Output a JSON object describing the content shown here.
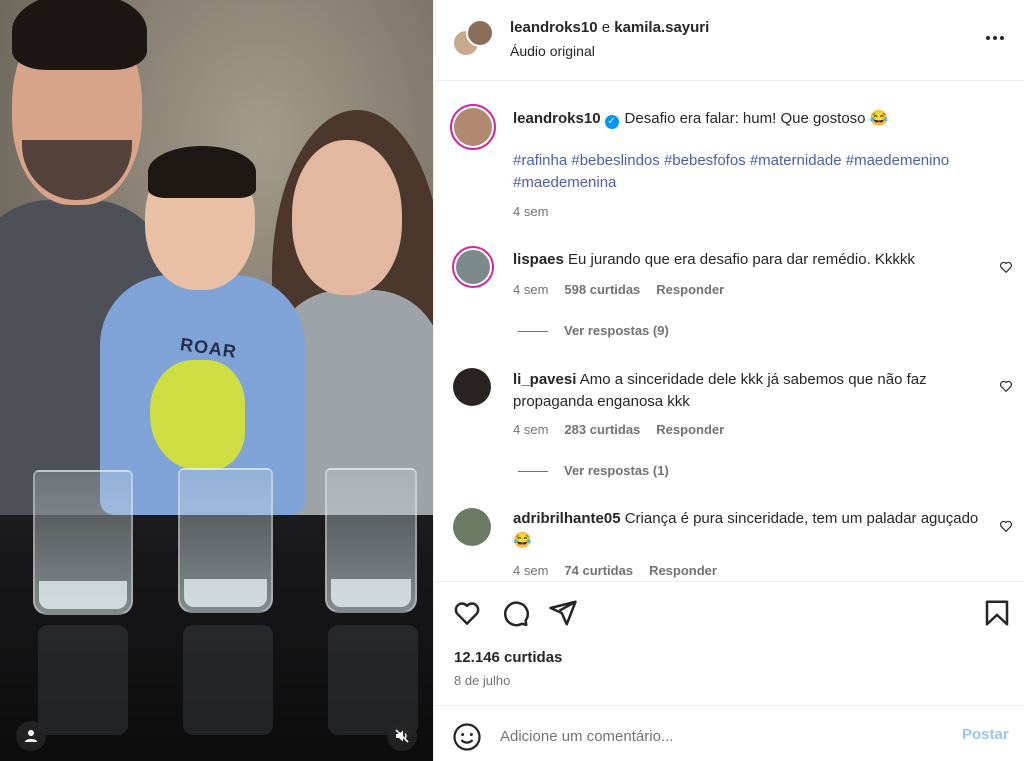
{
  "header": {
    "user1": "leandroks10",
    "connector": "e",
    "user2": "kamila.sayuri",
    "audio": "Áudio original"
  },
  "caption": {
    "username": "leandroks10",
    "text": "Desafio era falar: hum! Que gostoso 😂",
    "hashtags": "#rafinha #bebeslindos #bebesfofos #maternidade #maedemenino #maedemenina",
    "time": "4 sem"
  },
  "comments": [
    {
      "username": "lispaes",
      "text": "Eu jurando que era desafio para dar remédio. Kkkkk",
      "time": "4 sem",
      "likes": "598 curtidas",
      "reply": "Responder",
      "view_replies": "Ver respostas (9)"
    },
    {
      "username": "li_pavesi",
      "text": "Amo a sinceridade dele kkk já sabemos que não faz propaganda enganosa kkk",
      "time": "4 sem",
      "likes": "283 curtidas",
      "reply": "Responder",
      "view_replies": "Ver respostas (1)"
    },
    {
      "username": "adribrilhante05",
      "text": "Criança é pura sinceridade, tem um paladar aguçado 😂",
      "time": "4 sem",
      "likes": "74 curtidas",
      "reply": "Responder"
    }
  ],
  "post": {
    "likes": "12.146 curtidas",
    "date": "8 de julho"
  },
  "composer": {
    "placeholder": "Adicione um comentário...",
    "post_label": "Postar"
  },
  "media": {
    "shirt_text": "ROAR"
  },
  "colors": {
    "link": "#4b5fad",
    "post_disabled": "#9bc6ee",
    "verified": "#0095f6",
    "story_ring": "#d6249f"
  }
}
